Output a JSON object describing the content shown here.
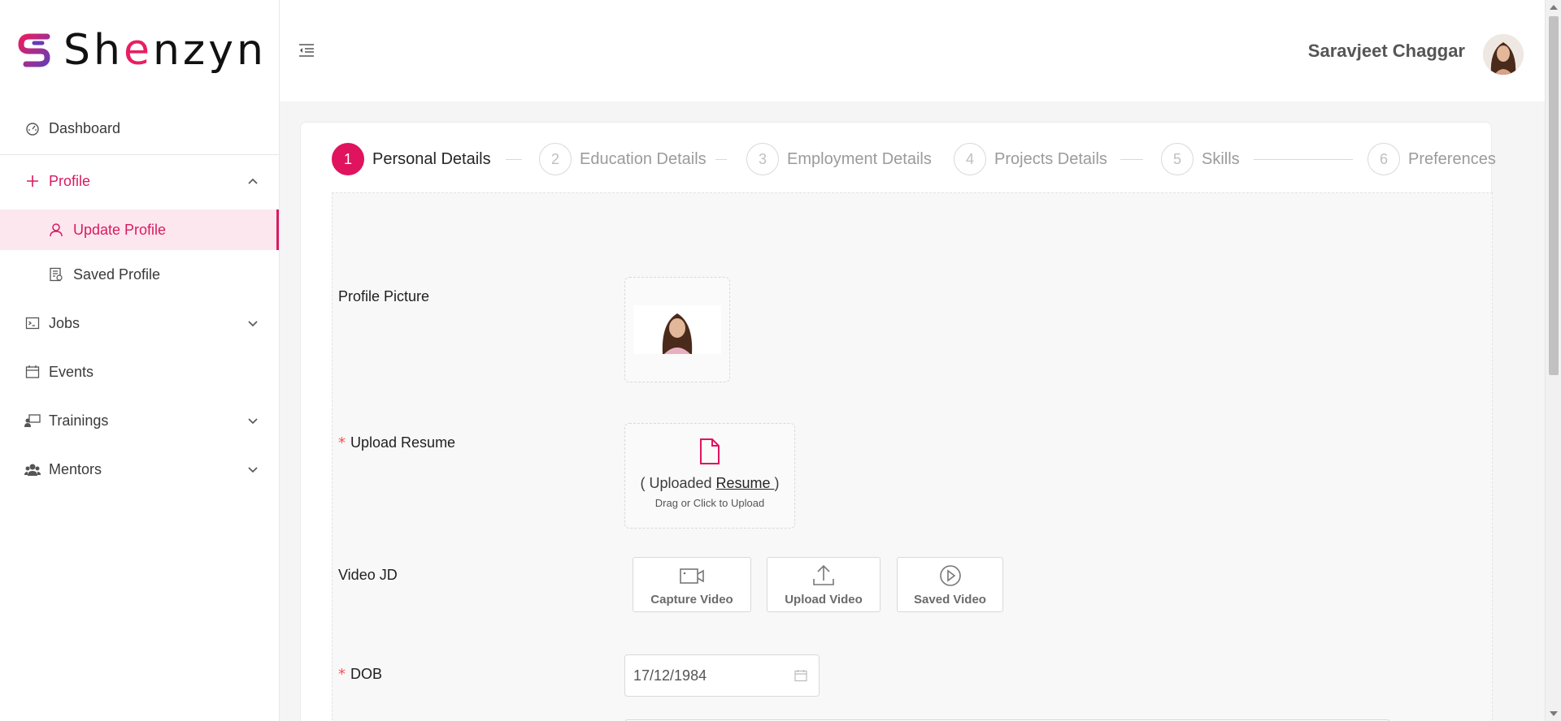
{
  "brand": {
    "name_pre": "Sh",
    "name_e": "e",
    "name_post": "nzyn",
    "accent_color": "#e0135e"
  },
  "sidebar": {
    "items": [
      {
        "label": "Dashboard",
        "icon": "dashboard-icon"
      },
      {
        "label": "Profile",
        "icon": "plus-icon",
        "expanded": true
      },
      {
        "label": "Update Profile",
        "icon": "user-icon",
        "selected": true
      },
      {
        "label": "Saved Profile",
        "icon": "saved-profile-icon"
      },
      {
        "label": "Jobs",
        "icon": "terminal-icon"
      },
      {
        "label": "Events",
        "icon": "calendar-icon"
      },
      {
        "label": "Trainings",
        "icon": "training-icon"
      },
      {
        "label": "Mentors",
        "icon": "team-icon"
      }
    ]
  },
  "header": {
    "user_name": "Saravjeet Chaggar"
  },
  "steps": [
    {
      "number": "1",
      "title": "Personal Details",
      "active": true
    },
    {
      "number": "2",
      "title": "Education Details"
    },
    {
      "number": "3",
      "title": "Employment Details"
    },
    {
      "number": "4",
      "title": "Projects Details"
    },
    {
      "number": "5",
      "title": "Skills"
    },
    {
      "number": "6",
      "title": "Preferences"
    }
  ],
  "form": {
    "profile_picture_label": "Profile Picture",
    "resume_label": "Upload Resume",
    "resume_status_pre": "( Uploaded ",
    "resume_link": "Resume ",
    "resume_status_post": ")",
    "resume_hint": "Drag or Click to Upload",
    "video_label": "Video JD",
    "video_buttons": [
      "Capture Video",
      "Upload Video",
      "Saved Video"
    ],
    "dob_label": "DOB",
    "dob_value": "17/12/1984",
    "required_mark": "*"
  }
}
